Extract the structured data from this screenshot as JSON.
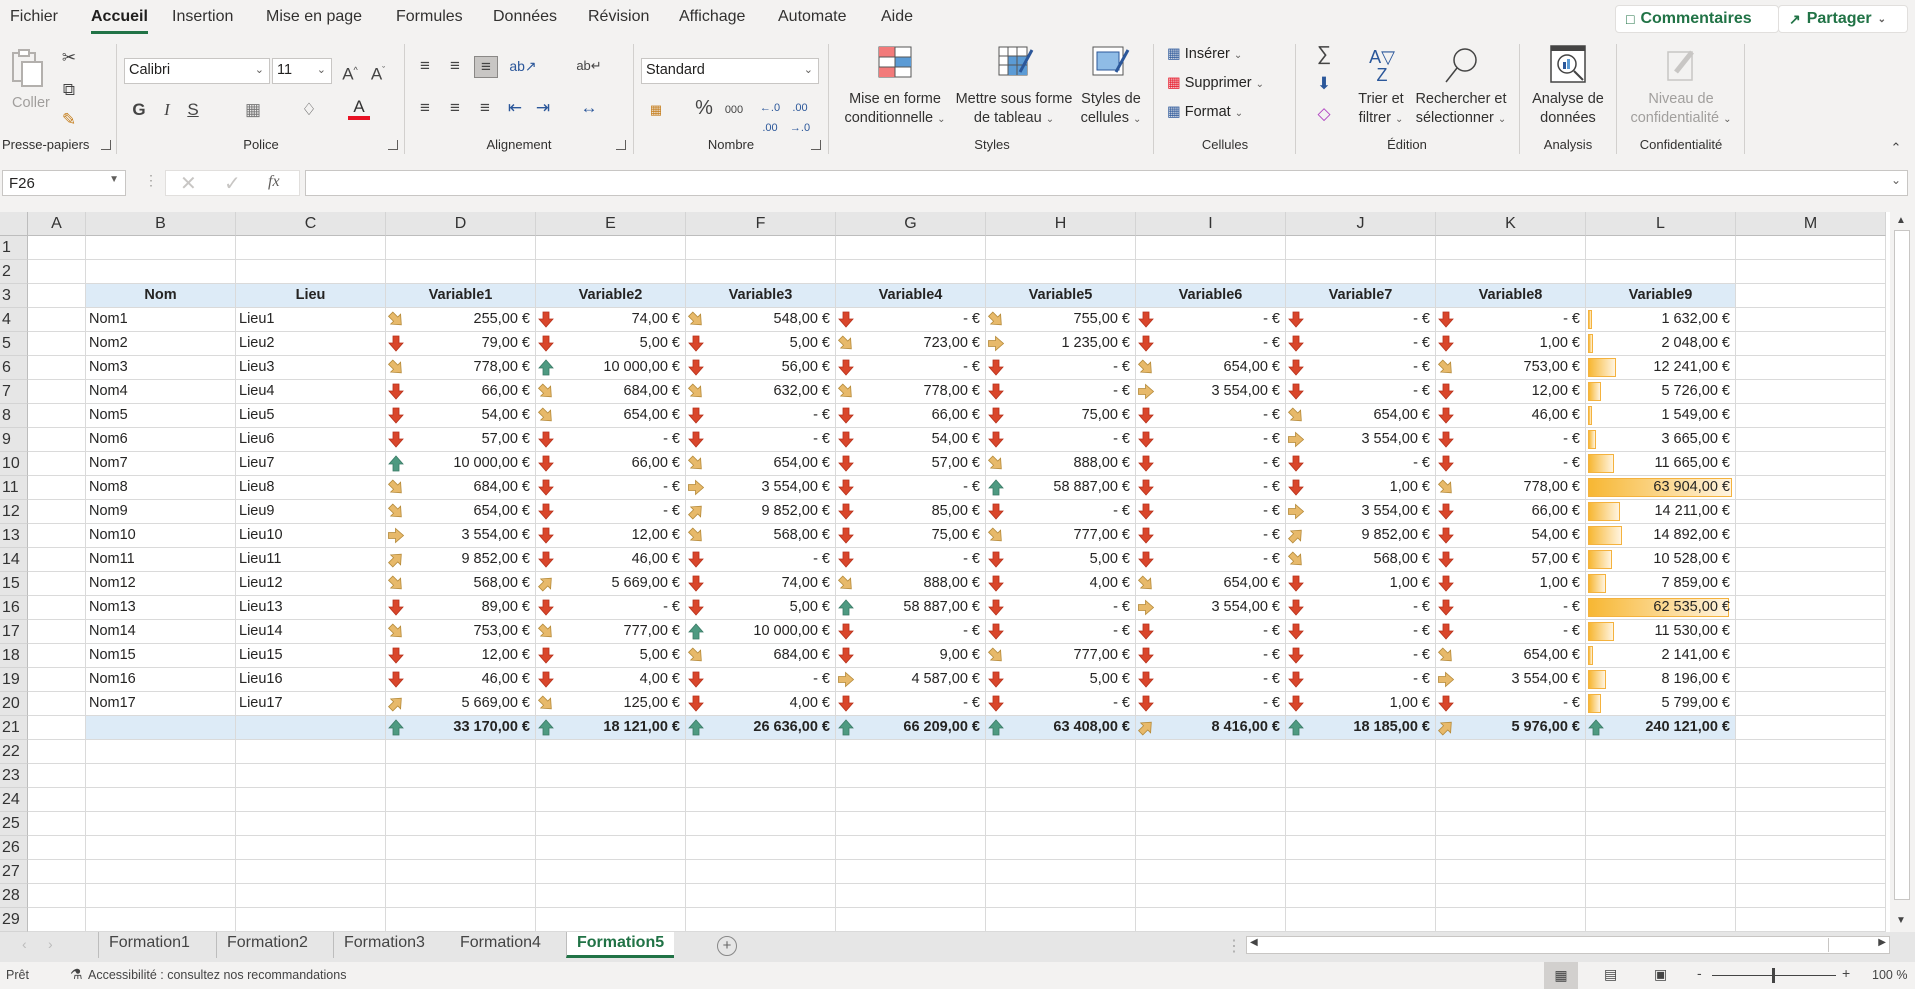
{
  "menu": {
    "tabs": [
      "Fichier",
      "Accueil",
      "Insertion",
      "Mise en page",
      "Formules",
      "Données",
      "Révision",
      "Affichage",
      "Automate",
      "Aide"
    ],
    "active_tab": "Accueil",
    "comments_label": "Commentaires",
    "share_label": "Partager"
  },
  "ribbon": {
    "clipboard": {
      "label": "Presse-papiers",
      "paste": "Coller"
    },
    "font": {
      "label": "Police",
      "font_name": "Calibri",
      "font_size": "11",
      "bold": "G",
      "italic": "I",
      "underline": "S"
    },
    "alignment": {
      "label": "Alignement"
    },
    "number": {
      "label": "Nombre",
      "format": "Standard",
      "percent": "%",
      "thousands": "000"
    },
    "styles": {
      "label": "Styles",
      "conditional_1": "Mise en forme",
      "conditional_2": "conditionnelle",
      "table_1": "Mettre sous forme",
      "table_2": "de tableau",
      "cellstyles_1": "Styles de",
      "cellstyles_2": "cellules"
    },
    "cells": {
      "label": "Cellules",
      "insert": "Insérer",
      "delete": "Supprimer",
      "format": "Format"
    },
    "editing": {
      "label": "Édition",
      "sort_1": "Trier et",
      "sort_2": "filtrer",
      "find_1": "Rechercher et",
      "find_2": "sélectionner"
    },
    "analysis": {
      "label": "Analysis",
      "analyze_1": "Analyse de",
      "analyze_2": "données"
    },
    "sensitivity": {
      "label": "Confidentialité",
      "level_1": "Niveau de",
      "level_2": "confidentialité"
    }
  },
  "formula_bar": {
    "name_box": "F26",
    "formula": "",
    "fx": "fx"
  },
  "columns": [
    "A",
    "B",
    "C",
    "D",
    "E",
    "F",
    "G",
    "H",
    "I",
    "J",
    "K",
    "L",
    "M"
  ],
  "rows": [
    "1",
    "2",
    "3",
    "4",
    "5",
    "6",
    "7",
    "8",
    "9",
    "10",
    "11",
    "12",
    "13",
    "14",
    "15",
    "16",
    "17",
    "18",
    "19",
    "20",
    "21",
    "22",
    "23",
    "24",
    "25",
    "26",
    "27",
    "28",
    "29"
  ],
  "table": {
    "headers": [
      "Nom",
      "Lieu",
      "Variable1",
      "Variable2",
      "Variable3",
      "Variable4",
      "Variable5",
      "Variable6",
      "Variable7",
      "Variable8",
      "Variable9"
    ],
    "records": [
      {
        "nom": "Nom1",
        "lieu": "Lieu1",
        "values": [
          "255,00 €",
          "74,00 €",
          "548,00 €",
          "-   €",
          "755,00 €",
          "-   €",
          "-   €",
          "-   €",
          "1 632,00 €"
        ],
        "icons": [
          "down-right",
          "down",
          "down-right",
          "down",
          "down-right",
          "down",
          "down",
          "down"
        ],
        "bar": 0.026
      },
      {
        "nom": "Nom2",
        "lieu": "Lieu2",
        "values": [
          "79,00 €",
          "5,00 €",
          "5,00 €",
          "723,00 €",
          "1 235,00 €",
          "-   €",
          "-   €",
          "1,00 €",
          "2 048,00 €"
        ],
        "icons": [
          "down",
          "down",
          "down",
          "down-right",
          "right",
          "down",
          "down",
          "down"
        ],
        "bar": 0.032
      },
      {
        "nom": "Nom3",
        "lieu": "Lieu3",
        "values": [
          "778,00 €",
          "10 000,00 €",
          "56,00 €",
          "-   €",
          "-   €",
          "654,00 €",
          "-   €",
          "753,00 €",
          "12 241,00 €"
        ],
        "icons": [
          "down-right",
          "up",
          "down",
          "down",
          "down",
          "down-right",
          "down",
          "down-right"
        ],
        "bar": 0.192
      },
      {
        "nom": "Nom4",
        "lieu": "Lieu4",
        "values": [
          "66,00 €",
          "684,00 €",
          "632,00 €",
          "778,00 €",
          "-   €",
          "3 554,00 €",
          "-   €",
          "12,00 €",
          "5 726,00 €"
        ],
        "icons": [
          "down",
          "down-right",
          "down-right",
          "down-right",
          "down",
          "right",
          "down",
          "down"
        ],
        "bar": 0.09
      },
      {
        "nom": "Nom5",
        "lieu": "Lieu5",
        "values": [
          "54,00 €",
          "654,00 €",
          "-   €",
          "66,00 €",
          "75,00 €",
          "-   €",
          "654,00 €",
          "46,00 €",
          "1 549,00 €"
        ],
        "icons": [
          "down",
          "down-right",
          "down",
          "down",
          "down",
          "down",
          "down-right",
          "down"
        ],
        "bar": 0.024
      },
      {
        "nom": "Nom6",
        "lieu": "Lieu6",
        "values": [
          "57,00 €",
          "-   €",
          "-   €",
          "54,00 €",
          "-   €",
          "-   €",
          "3 554,00 €",
          "-   €",
          "3 665,00 €"
        ],
        "icons": [
          "down",
          "down",
          "down",
          "down",
          "down",
          "down",
          "right",
          "down"
        ],
        "bar": 0.057
      },
      {
        "nom": "Nom7",
        "lieu": "Lieu7",
        "values": [
          "10 000,00 €",
          "66,00 €",
          "654,00 €",
          "57,00 €",
          "888,00 €",
          "-   €",
          "-   €",
          "-   €",
          "11 665,00 €"
        ],
        "icons": [
          "up",
          "down",
          "down-right",
          "down",
          "down-right",
          "down",
          "down",
          "down"
        ],
        "bar": 0.183
      },
      {
        "nom": "Nom8",
        "lieu": "Lieu8",
        "values": [
          "684,00 €",
          "-   €",
          "3 554,00 €",
          "-   €",
          "58 887,00 €",
          "-   €",
          "1,00 €",
          "778,00 €",
          "63 904,00 €"
        ],
        "icons": [
          "down-right",
          "down",
          "right",
          "down",
          "up",
          "down",
          "down",
          "down-right"
        ],
        "bar": 1.0
      },
      {
        "nom": "Nom9",
        "lieu": "Lieu9",
        "values": [
          "654,00 €",
          "-   €",
          "9 852,00 €",
          "85,00 €",
          "-   €",
          "-   €",
          "3 554,00 €",
          "66,00 €",
          "14 211,00 €"
        ],
        "icons": [
          "down-right",
          "down",
          "up-right",
          "down",
          "down",
          "down",
          "right",
          "down"
        ],
        "bar": 0.222
      },
      {
        "nom": "Nom10",
        "lieu": "Lieu10",
        "values": [
          "3 554,00 €",
          "12,00 €",
          "568,00 €",
          "75,00 €",
          "777,00 €",
          "-   €",
          "9 852,00 €",
          "54,00 €",
          "14 892,00 €"
        ],
        "icons": [
          "right",
          "down",
          "down-right",
          "down",
          "down-right",
          "down",
          "up-right",
          "down"
        ],
        "bar": 0.233
      },
      {
        "nom": "Nom11",
        "lieu": "Lieu11",
        "values": [
          "9 852,00 €",
          "46,00 €",
          "-   €",
          "-   €",
          "5,00 €",
          "-   €",
          "568,00 €",
          "57,00 €",
          "10 528,00 €"
        ],
        "icons": [
          "up-right",
          "down",
          "down",
          "down",
          "down",
          "down",
          "down-right",
          "down"
        ],
        "bar": 0.165
      },
      {
        "nom": "Nom12",
        "lieu": "Lieu12",
        "values": [
          "568,00 €",
          "5 669,00 €",
          "74,00 €",
          "888,00 €",
          "4,00 €",
          "654,00 €",
          "1,00 €",
          "1,00 €",
          "7 859,00 €"
        ],
        "icons": [
          "down-right",
          "up-right",
          "down",
          "down-right",
          "down",
          "down-right",
          "down",
          "down"
        ],
        "bar": 0.123
      },
      {
        "nom": "Nom13",
        "lieu": "Lieu13",
        "values": [
          "89,00 €",
          "-   €",
          "5,00 €",
          "58 887,00 €",
          "-   €",
          "3 554,00 €",
          "-   €",
          "-   €",
          "62 535,00 €"
        ],
        "icons": [
          "down",
          "down",
          "down",
          "up",
          "down",
          "right",
          "down",
          "down"
        ],
        "bar": 0.979
      },
      {
        "nom": "Nom14",
        "lieu": "Lieu14",
        "values": [
          "753,00 €",
          "777,00 €",
          "10 000,00 €",
          "-   €",
          "-   €",
          "-   €",
          "-   €",
          "-   €",
          "11 530,00 €"
        ],
        "icons": [
          "down-right",
          "down-right",
          "up",
          "down",
          "down",
          "down",
          "down",
          "down"
        ],
        "bar": 0.18
      },
      {
        "nom": "Nom15",
        "lieu": "Lieu15",
        "values": [
          "12,00 €",
          "5,00 €",
          "684,00 €",
          "9,00 €",
          "777,00 €",
          "-   €",
          "-   €",
          "654,00 €",
          "2 141,00 €"
        ],
        "icons": [
          "down",
          "down",
          "down-right",
          "down",
          "down-right",
          "down",
          "down",
          "down-right"
        ],
        "bar": 0.034
      },
      {
        "nom": "Nom16",
        "lieu": "Lieu16",
        "values": [
          "46,00 €",
          "4,00 €",
          "-   €",
          "4 587,00 €",
          "5,00 €",
          "-   €",
          "-   €",
          "3 554,00 €",
          "8 196,00 €"
        ],
        "icons": [
          "down",
          "down",
          "down",
          "right",
          "down",
          "down",
          "down",
          "right"
        ],
        "bar": 0.128
      },
      {
        "nom": "Nom17",
        "lieu": "Lieu17",
        "values": [
          "5 669,00 €",
          "125,00 €",
          "4,00 €",
          "-   €",
          "-   €",
          "-   €",
          "1,00 €",
          "-   €",
          "5 799,00 €"
        ],
        "icons": [
          "up-right",
          "down-right",
          "down",
          "down",
          "down",
          "down",
          "down",
          "down"
        ],
        "bar": 0.091
      }
    ],
    "totals": {
      "values": [
        "33 170,00 €",
        "18 121,00 €",
        "26 636,00 €",
        "66 209,00 €",
        "63 408,00 €",
        "8 416,00 €",
        "18 185,00 €",
        "5 976,00 €",
        "240 121,00 €"
      ],
      "icons": [
        "up",
        "up",
        "up",
        "up",
        "up",
        "up-right",
        "up",
        "up-right",
        "up"
      ]
    }
  },
  "icon_colors": {
    "down": "#d9462b",
    "down-right": "#e7b96a",
    "right": "#e7b96a",
    "up-right": "#e7b96a",
    "up": "#4e9a81"
  },
  "sheet_tabs": [
    "Formation1",
    "Formation2",
    "Formation3",
    "Formation4",
    "Formation5"
  ],
  "active_sheet": "Formation5",
  "status": {
    "ready": "Prêt",
    "accessibility": "Accessibilité : consultez nos recommandations",
    "zoom": "100 %"
  }
}
